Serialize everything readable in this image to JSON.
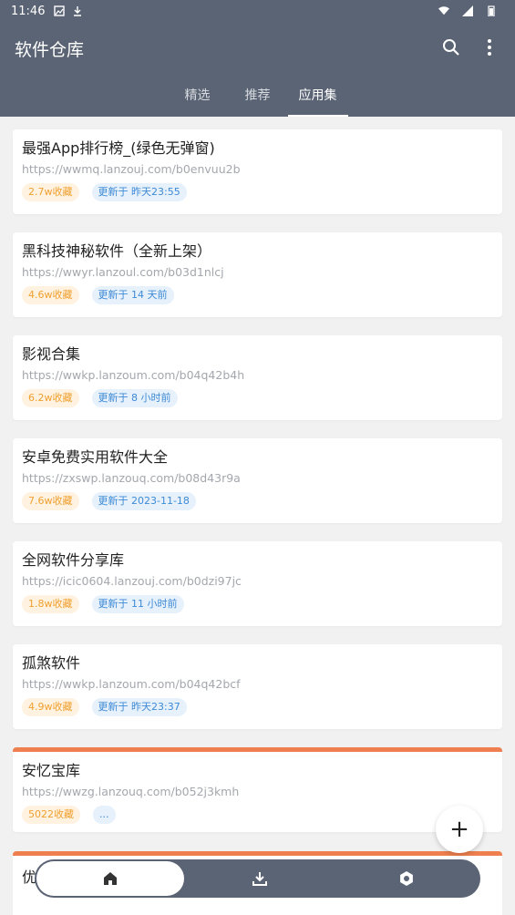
{
  "status_bar": {
    "time": "11:46"
  },
  "app_bar": {
    "title": "软件仓库",
    "tabs": [
      {
        "label": "精选"
      },
      {
        "label": "推荐"
      },
      {
        "label": "应用集",
        "active": true
      }
    ]
  },
  "cards": [
    {
      "name": "最强App排行榜_(绿色无弹窗)",
      "url": "https://wwmq.lanzouj.com/b0envuu2b",
      "favorites": "2.7w收藏",
      "updated": "更新于 昨天23:55",
      "accent": false
    },
    {
      "name": "黑科技神秘软件（全新上架）",
      "url": "https://wwyr.lanzoul.com/b03d1nlcj",
      "favorites": "4.6w收藏",
      "updated": "更新于 14 天前",
      "accent": false
    },
    {
      "name": "影视合集",
      "url": "https://wwkp.lanzoum.com/b04q42b4h",
      "favorites": "6.2w收藏",
      "updated": "更新于 8 小时前",
      "accent": false
    },
    {
      "name": "安卓免费实用软件大全",
      "url": "https://zxswp.lanzouq.com/b08d43r9a",
      "favorites": "7.6w收藏",
      "updated": "更新于 2023-11-18",
      "accent": false
    },
    {
      "name": "全网软件分享库",
      "url": "https://icic0604.lanzouj.com/b0dzi97jc",
      "favorites": "1.8w收藏",
      "updated": "更新于 11 小时前",
      "accent": false
    },
    {
      "name": "孤煞软件",
      "url": "https://wwkp.lanzoum.com/b04q42bcf",
      "favorites": "4.9w收藏",
      "updated": "更新于 昨天23:37",
      "accent": false
    },
    {
      "name": "安忆宝库",
      "url": "https://wwzg.lanzouq.com/b052j3kmh",
      "favorites": "5022收藏",
      "updated": "...",
      "accent": true
    }
  ],
  "partial_card": {
    "name": "优"
  },
  "fab": {
    "label": "+"
  },
  "bottom_nav": {
    "items": [
      {
        "icon": "home-icon",
        "active": true
      },
      {
        "icon": "download-icon",
        "active": false
      },
      {
        "icon": "settings-icon",
        "active": false
      }
    ]
  },
  "colors": {
    "primary": "#5b6474",
    "accent": "#ef7f4e",
    "fav_text": "#f0a030",
    "upd_text": "#3e8ad6"
  }
}
